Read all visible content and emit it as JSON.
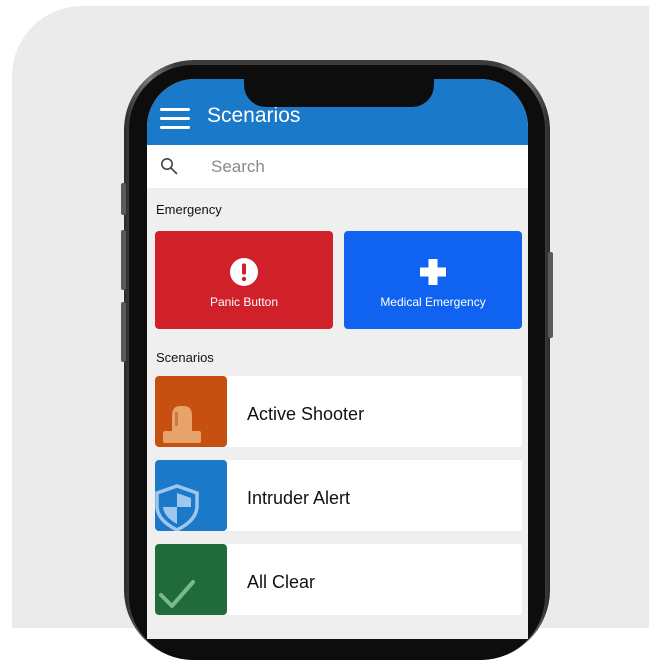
{
  "header": {
    "title": "Scenarios"
  },
  "search": {
    "placeholder": "Search"
  },
  "emergency": {
    "section_title": "Emergency",
    "buttons": [
      {
        "label": "Panic Button",
        "color": "#d0202a",
        "icon": "exclamation-circle-icon"
      },
      {
        "label": "Medical Emergency",
        "color": "#1063f0",
        "icon": "medical-cross-icon"
      }
    ]
  },
  "scenarios": {
    "section_title": "Scenarios",
    "items": [
      {
        "label": "Active Shooter",
        "color": "#c6500f",
        "icon": "siren-icon"
      },
      {
        "label": "Intruder Alert",
        "color": "#1a79c9",
        "icon": "shield-icon"
      },
      {
        "label": "All Clear",
        "color": "#1f6b3a",
        "icon": "checkmark-icon"
      }
    ]
  },
  "theme": {
    "header_color": "#1a79c9",
    "background": "#efefef"
  }
}
